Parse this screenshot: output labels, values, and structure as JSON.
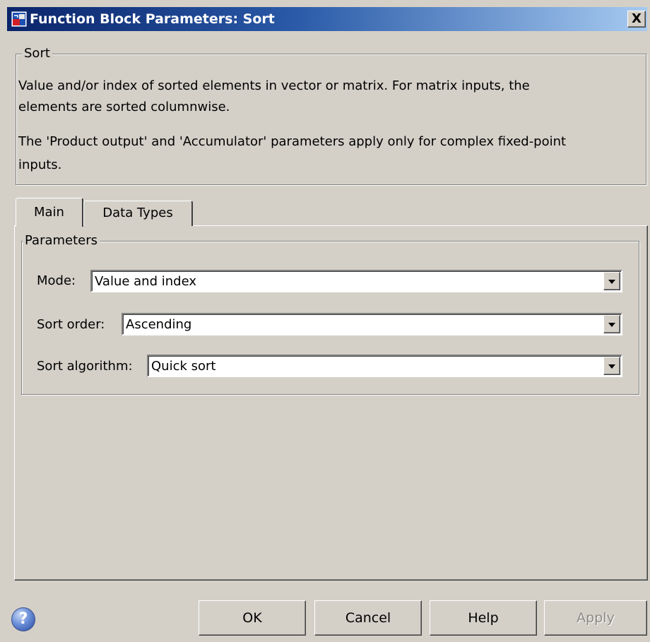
{
  "window": {
    "title": "Function Block Parameters: Sort",
    "close_glyph": "X",
    "icon": "simulink-block-icon"
  },
  "description_group": {
    "legend": "Sort",
    "lines": [
      "Value and/or index of sorted elements in vector or matrix.  For matrix inputs, the",
      "elements are sorted columnwise.",
      "The 'Product output' and 'Accumulator' parameters apply only for complex fixed-point",
      "inputs."
    ]
  },
  "tabs": [
    {
      "label": "Main",
      "selected": true
    },
    {
      "label": "Data Types",
      "selected": false
    }
  ],
  "parameters_group": {
    "legend": "Parameters",
    "fields": [
      {
        "label": "Mode:",
        "value": "Value and index"
      },
      {
        "label": "Sort order:",
        "value": "Ascending"
      },
      {
        "label": "Sort algorithm:",
        "value": "Quick sort"
      }
    ]
  },
  "buttons": {
    "help_icon_glyph": "?",
    "ok": "OK",
    "cancel": "Cancel",
    "help": "Help",
    "apply": "Apply",
    "apply_enabled": false
  },
  "colors": {
    "face": "#d4d0c8",
    "title_start": "#0a246a",
    "title_end": "#a6caf0",
    "disabled_text": "#8c8a84"
  }
}
